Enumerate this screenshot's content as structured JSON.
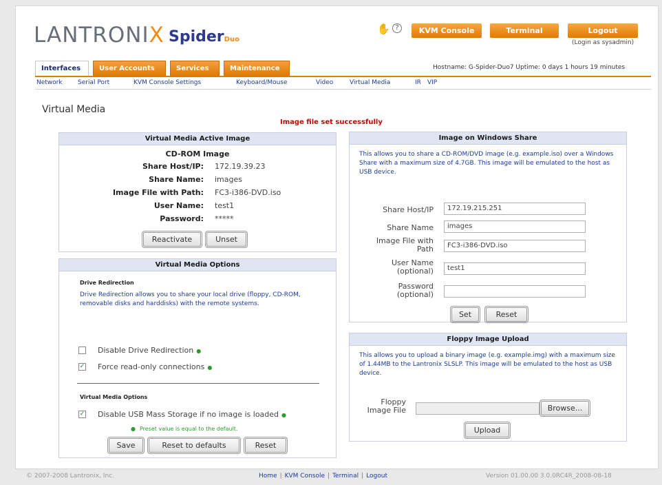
{
  "header": {
    "logo_main": "LANTRONI",
    "logo_x": "X",
    "logo_spider": "Spider",
    "logo_duo": "Duo",
    "buttons": {
      "kvm_console": "KVM Console",
      "terminal": "Terminal",
      "logout": "Logout"
    },
    "login_as": "(Login as sysadmin)",
    "host_line": "Hostname: G-Spider-Duo7   Uptime: 0 days 1 hours 19 minutes"
  },
  "tabs": [
    "Interfaces",
    "User Accounts",
    "Services",
    "Maintenance"
  ],
  "subnav": [
    "Network",
    "Serial Port",
    "KVM Console Settings",
    "Keyboard/Mouse",
    "Video",
    "Virtual Media",
    "IR",
    "VIP"
  ],
  "page_title": "Virtual Media",
  "status_message": "Image file set successfully",
  "active_image": {
    "title": "Virtual Media Active Image",
    "subtitle": "CD-ROM Image",
    "rows": [
      {
        "label": "Share Host/IP:",
        "value": "172.19.39.23"
      },
      {
        "label": "Share Name:",
        "value": "images"
      },
      {
        "label": "Image File with Path:",
        "value": "FC3-i386-DVD.iso"
      },
      {
        "label": "User Name:",
        "value": "test1"
      },
      {
        "label": "Password:",
        "value": "*****"
      }
    ],
    "reactivate": "Reactivate",
    "unset": "Unset"
  },
  "options": {
    "title": "Virtual Media Options",
    "drive_heading": "Drive Redirection",
    "drive_desc": "Drive Redirection allows you to share your local drive (floppy, CD-ROM, removable disks and harddisks) with the remote systems.",
    "disable_drive_label": "Disable Drive Redirection",
    "force_readonly_label": "Force read-only connections",
    "vm_heading": "Virtual Media Options",
    "disable_usb_label": "Disable USB Mass Storage if no image is loaded",
    "legend": "Preset value is equal to the default.",
    "save": "Save",
    "reset_defaults": "Reset to defaults",
    "reset": "Reset"
  },
  "windows_share": {
    "title": "Image on Windows Share",
    "desc": "This allows you to share a CD-ROM/DVD image (e.g. example.iso) over a Windows Share with a maximum size of 4.7GB. This image will be emulated to the host as USB device.",
    "share_host_label": "Share Host/IP",
    "share_host_value": "172.19.215.251",
    "share_name_label": "Share Name",
    "share_name_value": "images",
    "image_file_label": "Image File with Path",
    "image_file_value": "FC3-i386-DVD.iso",
    "user_label": "User Name (optional)",
    "user_value": "test1",
    "password_label": "Password (optional)",
    "password_value": "",
    "set": "Set",
    "reset": "Reset"
  },
  "floppy": {
    "title": "Floppy Image Upload",
    "desc": "This allows you to upload a binary image (e.g. example.img) with a maximum size of 1.44MB to the Lantronix SLSLP. This image will be emulated to the host as USB device.",
    "label": "Floppy Image File",
    "browse": "Browse...",
    "upload": "Upload"
  },
  "footer": {
    "copyright": "© 2007-2008 Lantronix, Inc.",
    "links": [
      "Home",
      "KVM Console",
      "Terminal",
      "Logout"
    ],
    "version": "Version 01.00.00 3.0.0RC4R_2008-08-18"
  }
}
